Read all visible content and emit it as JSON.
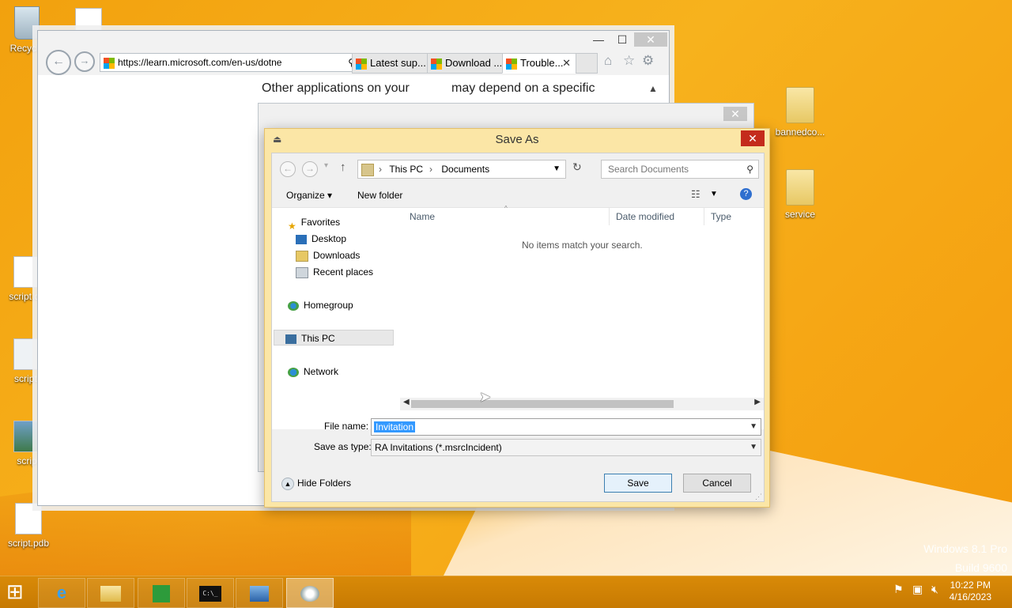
{
  "desktop": {
    "icons": [
      {
        "label": "Recycle"
      },
      {
        "label": ""
      },
      {
        "label": "script.de"
      },
      {
        "label": "script."
      },
      {
        "label": "scrip"
      },
      {
        "label": "script.pdb"
      },
      {
        "label": "bannedco..."
      },
      {
        "label": "service"
      }
    ],
    "watermark_line1": "Windows 8.1 Pro",
    "watermark_line2": "Build 9600"
  },
  "browser": {
    "url": "https://learn.microsoft.com/en-us/dotne",
    "tabs": [
      {
        "label": "Latest sup..."
      },
      {
        "label": "Download ..."
      },
      {
        "label": "Trouble..."
      }
    ],
    "page_text_left": "Other applications on your",
    "page_text_right": "may depend on a specific",
    "minimize": "—",
    "maximize": "☐",
    "close": "✕"
  },
  "save_as": {
    "title": "Save As",
    "close": "✕",
    "breadcrumb": [
      "This PC",
      "Documents"
    ],
    "search_placeholder": "Search Documents",
    "organize": "Organize ▾",
    "new_folder": "New folder",
    "nav": {
      "favorites": "Favorites",
      "desktop": "Desktop",
      "downloads": "Downloads",
      "recent": "Recent places",
      "homegroup": "Homegroup",
      "this_pc": "This PC",
      "network": "Network"
    },
    "columns": {
      "name": "Name",
      "date_modified": "Date modified",
      "type": "Type"
    },
    "empty_message": "No items match your search.",
    "file_name_label": "File name:",
    "file_name_value": "Invitation",
    "save_as_type_label": "Save as type:",
    "save_as_type_value": "RA Invitations (*.msrcIncident)",
    "hide_folders": "Hide Folders",
    "save": "Save",
    "cancel": "Cancel"
  },
  "taskbar": {
    "start": "⊞",
    "clock_time": "10:22 PM",
    "clock_date": "4/16/2023",
    "cmd_label": "C:\\_"
  }
}
